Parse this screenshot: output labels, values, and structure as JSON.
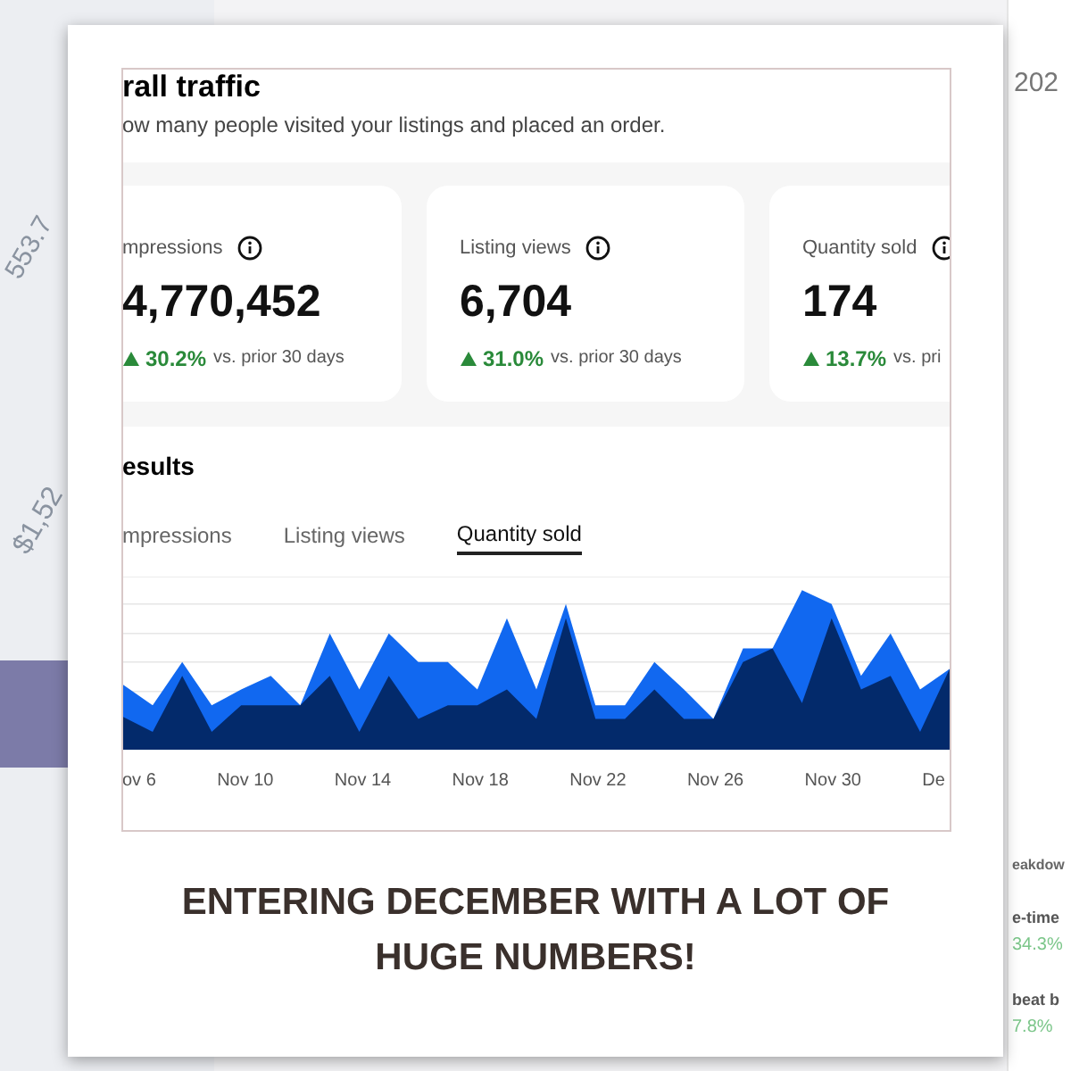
{
  "background": {
    "left_texts": [
      "553.7",
      "$1,52"
    ],
    "right_panel": {
      "year": "202",
      "section": "eakdow",
      "rows": [
        {
          "label": "e-time",
          "value": "34.3%"
        },
        {
          "label": "beat b",
          "value": "7.8%"
        }
      ]
    }
  },
  "screenshot": {
    "title": "rall traffic",
    "subtitle": "ow many people visited your listings and placed an order.",
    "stats": [
      {
        "label": "mpressions",
        "value": "4,770,452",
        "change": "30.2%",
        "note": "vs. prior 30 days"
      },
      {
        "label": "Listing views",
        "value": "6,704",
        "change": "31.0%",
        "note": "vs. prior 30 days"
      },
      {
        "label": "Quantity sold",
        "value": "174",
        "change": "13.7%",
        "note": "vs. pri"
      }
    ],
    "results_title": "esults",
    "tabs": [
      {
        "label": "mpressions",
        "selected": false
      },
      {
        "label": "Listing views",
        "selected": false
      },
      {
        "label": "Quantity sold",
        "selected": true
      }
    ],
    "x_labels": [
      "ov 6",
      "Nov 10",
      "Nov 14",
      "Nov 18",
      "Nov 22",
      "Nov 26",
      "Nov 30",
      "De"
    ]
  },
  "caption": "ENTERING DECEMBER WITH A LOT OF HUGE NUMBERS!"
}
